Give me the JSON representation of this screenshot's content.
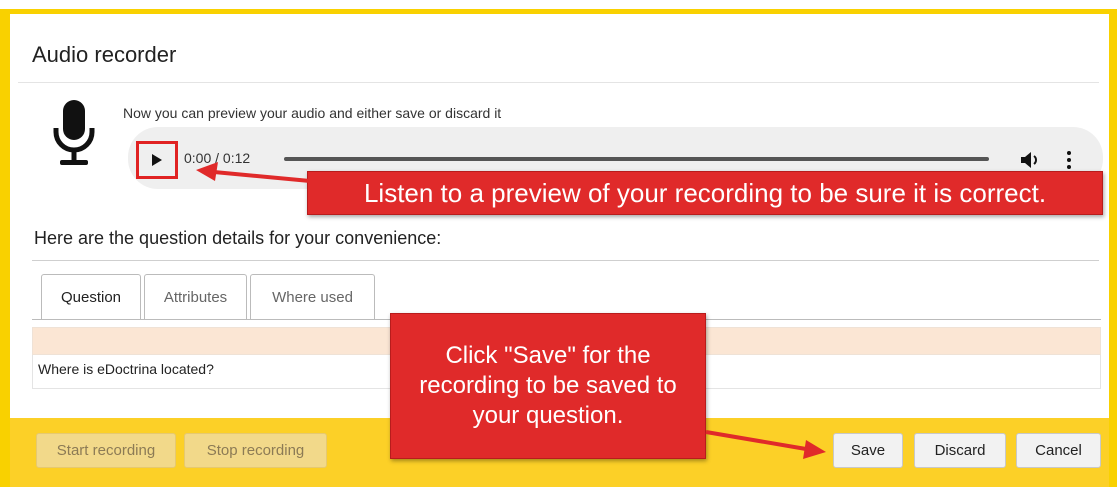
{
  "dialog": {
    "title": "Audio recorder"
  },
  "recorder": {
    "icon": "microphone-icon",
    "preview_text": "Now you can preview your audio and either save or discard it",
    "player": {
      "current_time": "0:00",
      "separator": " / ",
      "duration": "0:12",
      "time_display": "0:00 / 0:12",
      "progress": 0,
      "play_icon": "play-icon",
      "volume_icon": "volume-icon",
      "more_icon": "more-options-icon"
    }
  },
  "details": {
    "heading": "Here are the question details for your convenience:",
    "tabs": [
      {
        "label": "Question",
        "active": true
      },
      {
        "label": "Attributes",
        "active": false
      },
      {
        "label": "Where used",
        "active": false
      }
    ],
    "question_text": "Where is eDoctrina located?"
  },
  "footer": {
    "start_recording": "Start recording",
    "stop_recording": "Stop recording",
    "save": "Save",
    "discard": "Discard",
    "cancel": "Cancel"
  },
  "annotations": {
    "listen_callout": "Listen to a preview of your recording to be sure it is correct.",
    "save_callout": "Click \"Save\" for the recording to be saved to your question."
  },
  "colors": {
    "frame": "#f9d100",
    "footer": "#fcd027",
    "callout": "#e02a2a",
    "panel_header": "#fbe6d4"
  }
}
